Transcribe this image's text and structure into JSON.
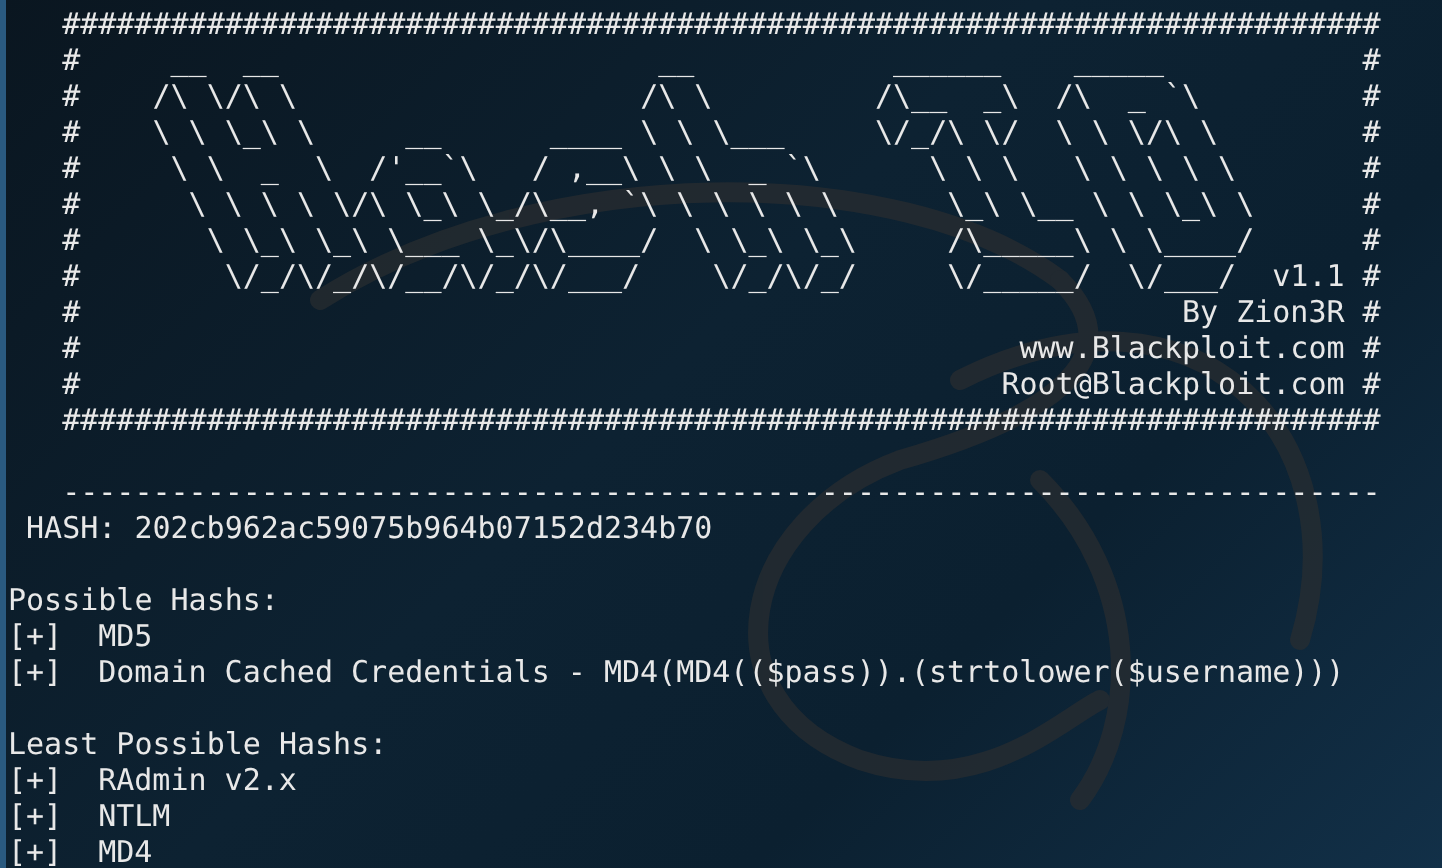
{
  "terminal": {
    "banner": [
      "   #########################################################################",
      "   #     __  __                     __           ______    _____           #",
      "   #    /\\ \\/\\ \\                   /\\ \\         /\\__  _\\  /\\  _ `\\         #",
      "   #    \\ \\ \\_\\ \\     __      ____ \\ \\ \\___     \\/_/\\ \\/  \\ \\ \\/\\ \\        #",
      "   #     \\ \\  _  \\  /'__`\\   / ,__\\ \\ \\  _ `\\      \\ \\ \\   \\ \\ \\ \\ \\       #",
      "   #      \\ \\ \\ \\ \\/\\ \\_\\ \\_/\\__, `\\ \\ \\ \\ \\ \\      \\_\\ \\__ \\ \\ \\_\\ \\      #",
      "   #       \\ \\_\\ \\_\\ \\___ \\_\\/\\____/  \\ \\_\\ \\_\\     /\\_____\\ \\ \\____/      #",
      "   #        \\/_/\\/_/\\/__/\\/_/\\/___/    \\/_/\\/_/     \\/_____/  \\/___/  v1.1 #",
      "   #                                                             By Zion3R #",
      "   #                                                    www.Blackploit.com #",
      "   #                                                   Root@Blackploit.com #",
      "   #########################################################################"
    ],
    "separator": "   -------------------------------------------------------------------------",
    "hash_label": " HASH:",
    "hash_value": "202cb962ac59075b964b07152d234b70",
    "sections": [
      {
        "title": "Possible Hashs:",
        "items": [
          {
            "marker": "[+]",
            "name": "MD5"
          },
          {
            "marker": "[+]",
            "name": "Domain Cached Credentials - MD4(MD4(($pass)).(strtolower($username)))"
          }
        ]
      },
      {
        "title": "Least Possible Hashs:",
        "items": [
          {
            "marker": "[+]",
            "name": "RAdmin v2.x"
          },
          {
            "marker": "[+]",
            "name": "NTLM"
          },
          {
            "marker": "[+]",
            "name": "MD4"
          }
        ]
      }
    ]
  }
}
